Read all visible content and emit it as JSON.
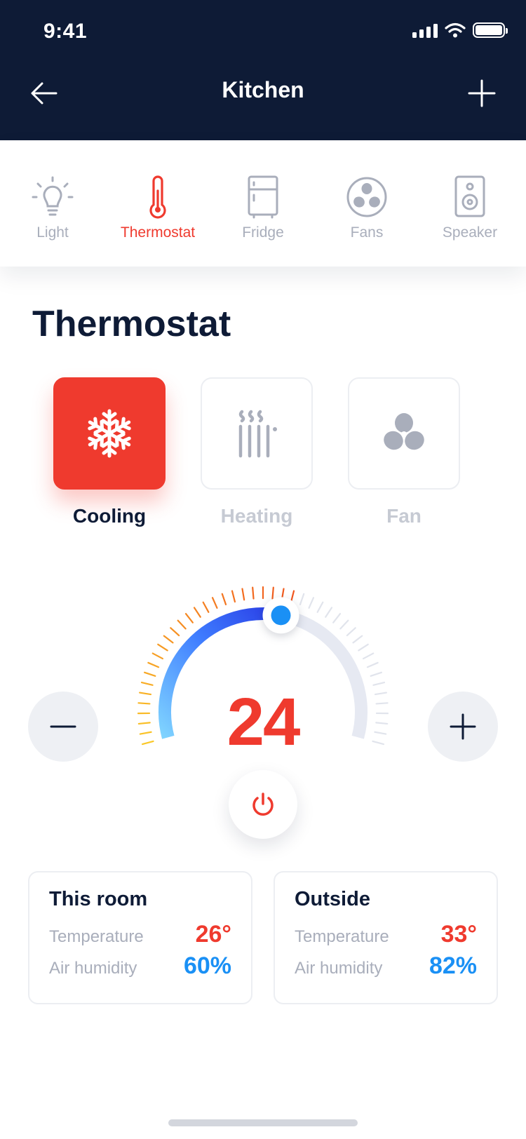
{
  "status_bar": {
    "time": "9:41"
  },
  "nav": {
    "title": "Kitchen"
  },
  "devices": [
    {
      "label": "Light",
      "icon": "bulb-icon"
    },
    {
      "label": "Thermostat",
      "icon": "thermometer-icon",
      "active": true
    },
    {
      "label": "Fridge",
      "icon": "fridge-icon"
    },
    {
      "label": "Fans",
      "icon": "fan-icon"
    },
    {
      "label": "Speaker",
      "icon": "speaker-icon"
    }
  ],
  "section": {
    "title": "Thermostat"
  },
  "modes": [
    {
      "label": "Cooling",
      "icon": "snowflake-icon",
      "active": true
    },
    {
      "label": "Heating",
      "icon": "heater-icon"
    },
    {
      "label": "Fan",
      "icon": "fan-icon"
    }
  ],
  "dial": {
    "value": "24",
    "level_fraction": 0.55
  },
  "cards": [
    {
      "title": "This room",
      "temp_label": "Temperature",
      "temp": "26°",
      "hum_label": "Air humidity",
      "hum": "60%"
    },
    {
      "title": "Outside",
      "temp_label": "Temperature",
      "temp": "33°",
      "hum_label": "Air humidity",
      "hum": "82%"
    }
  ],
  "colors": {
    "navy": "#0e1b36",
    "accent_red": "#ef3a2e",
    "accent_blue": "#1a90f5",
    "muted": "#a9aebb"
  }
}
